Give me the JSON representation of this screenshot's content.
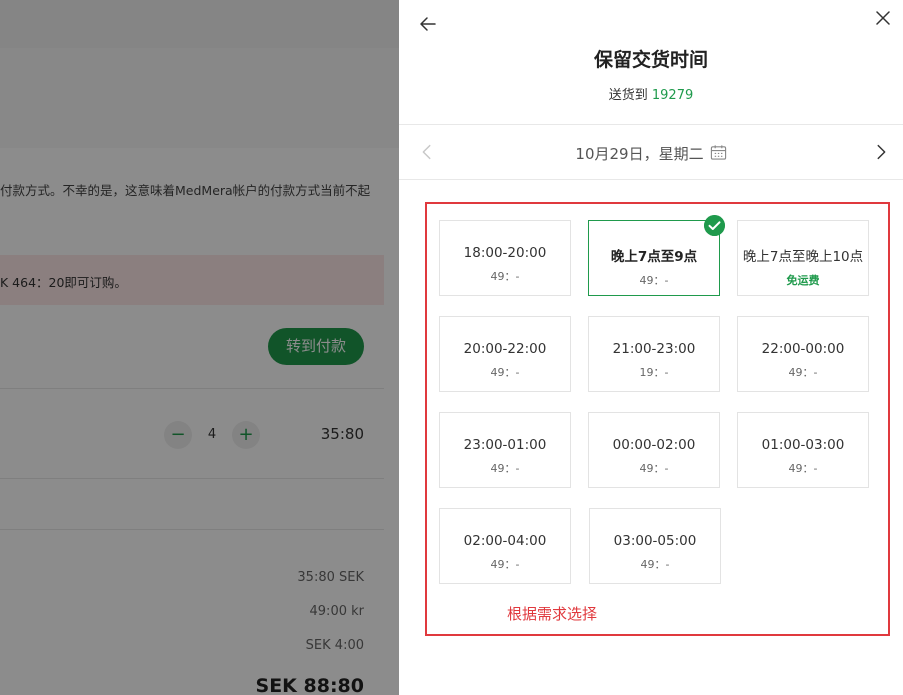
{
  "background": {
    "notice_text": "付款方式。不幸的是，这意味着MedMera帐户的付款方式当前不起",
    "warning_text": "K 464：20即可订购。",
    "checkout_button": "转到付款",
    "quantity": "4",
    "item_price": "35:80",
    "summary": [
      "35:80 SEK",
      "49:00 kr",
      "SEK 4:00"
    ],
    "total": "SEK 88:80"
  },
  "drawer": {
    "title": "保留交货时间",
    "deliver_prefix": "送货到",
    "zip": "19279",
    "date": "10月29日，星期二",
    "slots": [
      {
        "time": "18:00-20:00",
        "sub": "49：-",
        "selected": false,
        "free": false
      },
      {
        "time": "晚上7点至9点",
        "sub": "49：-",
        "selected": true,
        "free": false
      },
      {
        "time": "晚上7点至晚上10点",
        "sub": "免运费",
        "selected": false,
        "free": true
      },
      {
        "time": "20:00-22:00",
        "sub": "49：-",
        "selected": false,
        "free": false
      },
      {
        "time": "21:00-23:00",
        "sub": "19：-",
        "selected": false,
        "free": false
      },
      {
        "time": "22:00-00:00",
        "sub": "49：-",
        "selected": false,
        "free": false
      },
      {
        "time": "23:00-01:00",
        "sub": "49：-",
        "selected": false,
        "free": false
      },
      {
        "time": "00:00-02:00",
        "sub": "49：-",
        "selected": false,
        "free": false
      },
      {
        "time": "01:00-03:00",
        "sub": "49：-",
        "selected": false,
        "free": false
      },
      {
        "time": "02:00-04:00",
        "sub": "49：-",
        "selected": false,
        "free": false
      },
      {
        "time": "03:00-05:00",
        "sub": "49：-",
        "selected": false,
        "free": false
      }
    ],
    "annotation": "根据需求选择"
  },
  "colors": {
    "accent_green": "#1f9a4c",
    "annotation_red": "#e0393e"
  },
  "icons": [
    "back-arrow-icon",
    "close-icon",
    "chevron-left-icon",
    "chevron-right-icon",
    "calendar-icon",
    "checkmark-icon",
    "minus-icon",
    "plus-icon"
  ]
}
